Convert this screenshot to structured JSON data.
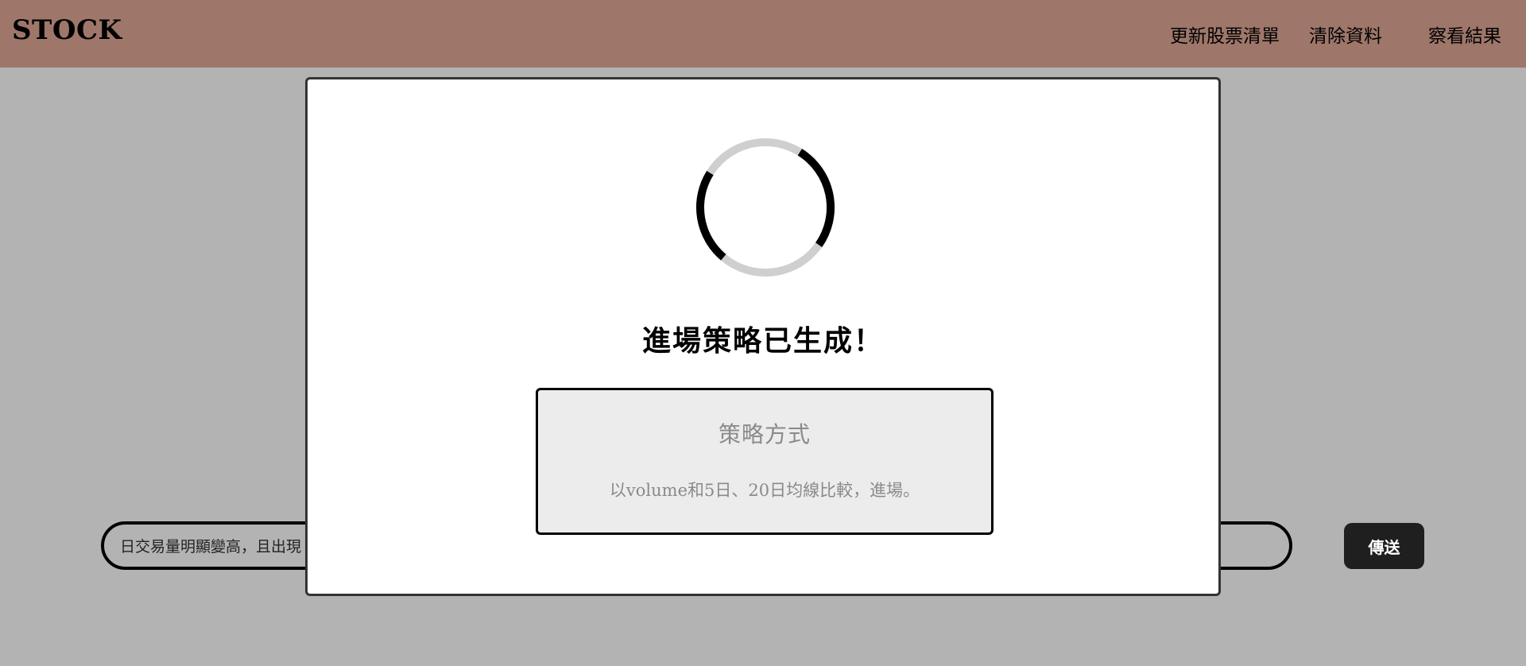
{
  "navbar": {
    "brand": "STOCK",
    "links": {
      "update_stock_list": "更新股票清單",
      "clear_data": "清除資料",
      "view_results": "察看結果"
    },
    "background_color": "#9e776a"
  },
  "chat": {
    "input_value": "日交易量明顯變高，且出現",
    "send_label": "傳送"
  },
  "modal": {
    "spinner_icon": "loading-spinner",
    "title": "進場策略已生成！",
    "strategy": {
      "heading": "策略方式",
      "detail": "以volume和5日、20日均線比較，進場。"
    }
  },
  "colors": {
    "overlay": "#b3b3b3",
    "modal_background": "#ffffff",
    "strategy_box_background": "#ececec",
    "send_button": "#1f1f1f"
  }
}
